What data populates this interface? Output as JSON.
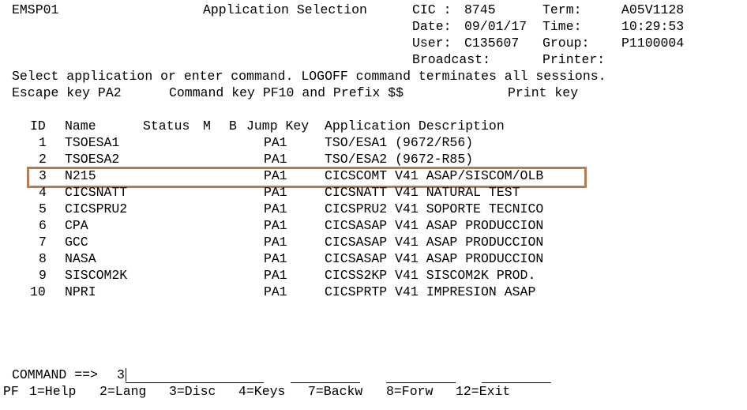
{
  "header": {
    "screen_id": "EMSP01",
    "title": "Application Selection",
    "cic_label": "CIC :",
    "cic_value": "8745",
    "term_label": "Term:",
    "term_value": "A05V1128",
    "date_label": "Date:",
    "date_value": "09/01/17",
    "time_label": "Time:",
    "time_value": "10:29:53",
    "user_label": "User:",
    "user_value": "C135607",
    "group_label": "Group:",
    "group_value": "P1100004",
    "broadcast_label": "Broadcast:",
    "printer_label": "Printer:"
  },
  "instructions": {
    "line1": "Select application or enter command. LOGOFF command terminates all sessions.",
    "escape": "Escape key PA2",
    "command_key": "Command key PF10 and Prefix $$",
    "print_key": "Print key"
  },
  "table": {
    "headers": {
      "id": "ID",
      "name": "Name",
      "status": "Status",
      "m": "M",
      "b": "B",
      "jump_key": "Jump Key",
      "app_desc": "Application Description"
    },
    "rows": [
      {
        "id": "1",
        "name": "TSOESA1",
        "key": "PA1",
        "desc": "TSO/ESA1 (9672/R56)"
      },
      {
        "id": "2",
        "name": "TSOESA2",
        "key": "PA1",
        "desc": "TSO/ESA2 (9672-R85)"
      },
      {
        "id": "3",
        "name": "N215",
        "key": "PA1",
        "desc": "CICSCOMT V41 ASAP/SISCOM/OLB"
      },
      {
        "id": "4",
        "name": "CICSNATT",
        "key": "PA1",
        "desc": "CICSNATT V41 NATURAL TEST"
      },
      {
        "id": "5",
        "name": "CICSPRU2",
        "key": "PA1",
        "desc": "CICSPRU2 V41 SOPORTE TECNICO"
      },
      {
        "id": "6",
        "name": "CPA",
        "key": "PA1",
        "desc": "CICSASAP V41 ASAP PRODUCCION"
      },
      {
        "id": "7",
        "name": "GCC",
        "key": "PA1",
        "desc": "CICSASAP V41 ASAP PRODUCCION"
      },
      {
        "id": "8",
        "name": "NASA",
        "key": "PA1",
        "desc": "CICSASAP V41 ASAP PRODUCCION"
      },
      {
        "id": "9",
        "name": "SISCOM2K",
        "key": "PA1",
        "desc": "CICSS2KP V41 SISCOM2K PROD."
      },
      {
        "id": "10",
        "name": "NPRI",
        "key": "PA1",
        "desc": "CICSPRTP V41 IMPRESION ASAP"
      }
    ]
  },
  "command": {
    "label": "COMMAND ==>",
    "value": "3"
  },
  "pf_keys": {
    "prefix": "PF",
    "help": "1=Help",
    "lang": "2=Lang",
    "disc": "3=Disc",
    "keys": "4=Keys",
    "backw": "7=Backw",
    "forw": "8=Forw",
    "exit": "12=Exit"
  },
  "colors": {
    "highlight_border": "#b87c52",
    "text": "#000000",
    "background": "#ffffff"
  }
}
